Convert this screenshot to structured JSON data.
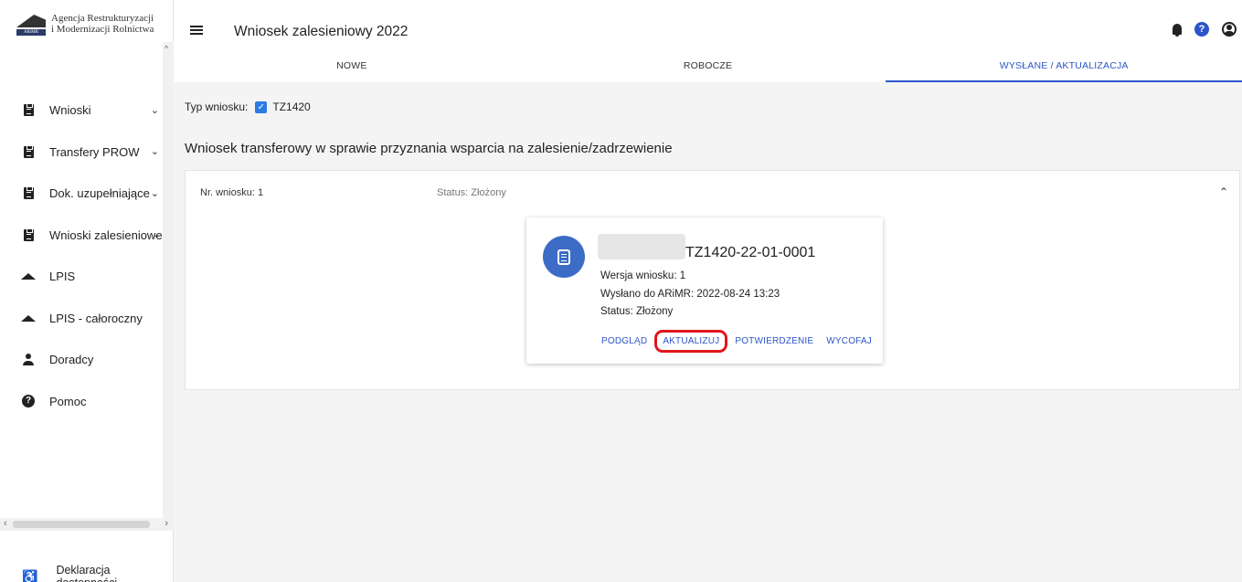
{
  "logo": {
    "line1": "Agencja Restrukturyzacji",
    "line2": "i Modernizacji Rolnictwa",
    "mark_text": "ARiMR"
  },
  "sidebar": {
    "items": [
      {
        "label": "Wnioski",
        "icon": "clipboard-icon",
        "has_chevron": true
      },
      {
        "label": "Transfery PROW",
        "icon": "clipboard-icon",
        "has_chevron": true
      },
      {
        "label": "Dok. uzupełniające",
        "icon": "clipboard-icon",
        "has_chevron": true
      },
      {
        "label": "Wnioski zalesieniowe",
        "icon": "clipboard-icon",
        "has_chevron": true
      },
      {
        "label": "LPIS",
        "icon": "terrain-icon",
        "has_chevron": false
      },
      {
        "label": "LPIS - całoroczny",
        "icon": "terrain-icon",
        "has_chevron": false
      },
      {
        "label": "Doradcy",
        "icon": "person-icon",
        "has_chevron": false
      },
      {
        "label": "Pomoc",
        "icon": "help-icon",
        "has_chevron": false
      }
    ],
    "accessibility": "Deklaracja dostępności"
  },
  "header": {
    "title": "Wniosek zalesieniowy 2022"
  },
  "tabs": [
    {
      "label": "NOWE",
      "active": false
    },
    {
      "label": "ROBOCZE",
      "active": false
    },
    {
      "label": "WYSŁANE / AKTUALIZACJA",
      "active": true
    }
  ],
  "filter": {
    "label": "Typ wniosku:",
    "checkbox_label": "TZ1420",
    "checked": true
  },
  "section_title": "Wniosek transferowy w sprawie przyznania wsparcia na zalesienie/zadrzewienie",
  "panel": {
    "number_label": "Nr. wniosku: 1",
    "status_label": "Status: Złożony"
  },
  "card": {
    "number": "TZ1420-22-01-0001",
    "version": "Wersja wniosku: 1",
    "sent": "Wysłano do ARiMR: 2022-08-24 13:23",
    "status": "Status: Złożony",
    "actions": [
      "PODGLĄD",
      "AKTUALIZUJ",
      "POTWIERDZENIE",
      "WYCOFAJ"
    ],
    "highlighted_action": "AKTUALIZUJ"
  },
  "colors": {
    "accent": "#2c55c8",
    "highlight": "#e0151b",
    "doc_circle": "#3d6cc6"
  }
}
